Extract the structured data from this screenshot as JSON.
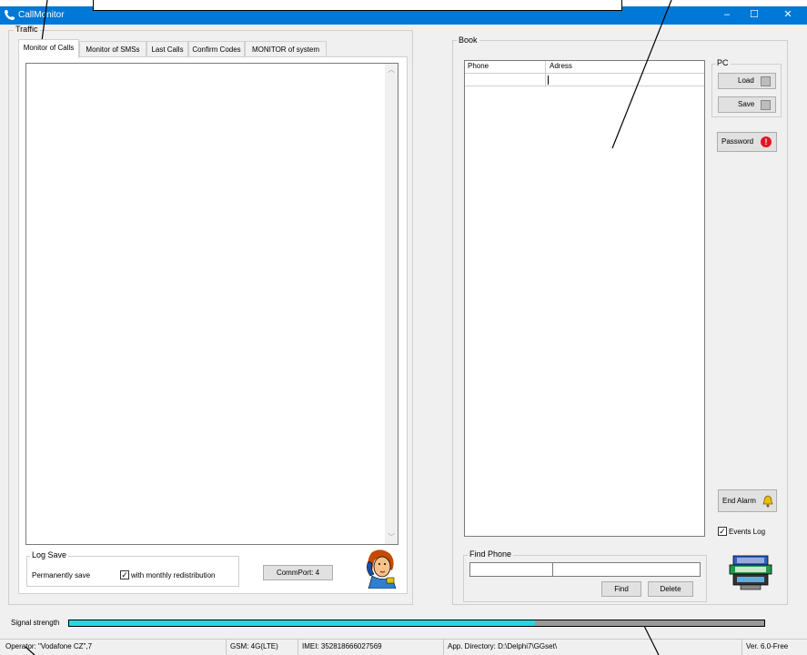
{
  "window": {
    "title": "CallMonitor",
    "buttons": [
      "–",
      "☐",
      "✕"
    ]
  },
  "traffic": {
    "label": "Traffic",
    "tabs": [
      "Monitor of Calls",
      "Monitor of SMSs",
      "Last Calls",
      "Confirm Codes",
      "MONITOR of system"
    ],
    "active_tab": 0,
    "log_save": {
      "label": "Log Save",
      "permanently_save": "Permanently save",
      "monthly_label": "with monthly redistribution",
      "monthly_checked": true,
      "checkmark": "✓"
    },
    "commport_label": "CommPort: 4"
  },
  "book": {
    "label": "Book",
    "columns": [
      "Phone",
      "Adress"
    ],
    "rows": [
      [
        "",
        ""
      ]
    ],
    "pc": {
      "label": "PC",
      "load_label": "Load",
      "save_label": "Save"
    },
    "password_label": "Password",
    "password_badge": "!",
    "end_alarm_label": "End Alarm",
    "events_log_label": "Events Log",
    "events_log_checked": true,
    "checkmark": "✓",
    "find_phone": {
      "label": "Find Phone",
      "value1": "",
      "value2": "",
      "find_label": "Find",
      "delete_label": "Delete"
    }
  },
  "signal": {
    "label": "Signal strength",
    "level_fraction": 0.67
  },
  "status_bar": {
    "operator": "Operator: \"Vodafone CZ\",7",
    "gsm": "GSM: 4G(LTE)",
    "imei": "IMEI: 352818666027569",
    "app_dir": "App. Directory: D:\\Delphi7\\GGset\\",
    "version": "Ver. 6.0-Free"
  },
  "colors": {
    "titlebar": "#0078d7",
    "signal_fill": "#23d8e3",
    "signal_empty": "#9a9a9a",
    "password_badge": "#e81123"
  }
}
